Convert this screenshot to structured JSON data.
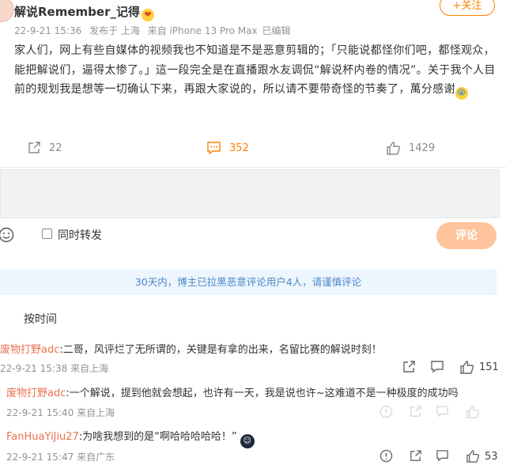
{
  "post": {
    "username": "解说Remember_记得",
    "username_emoji": "❤",
    "follow_label": "+关注",
    "time": "22-9-21 15:36",
    "location": "发布于 上海",
    "device": "来自 iPhone 13 Pro Max",
    "edited": "已编辑",
    "content_main": "家人们，网上有些自媒体的视频我也不知道是不是恶意剪辑的；「只能说都怪你们吧，都怪观众，能把解说们，逼得太惨了。」這一段完全是在直播跟水友调侃“解说杯内卷的情况”。关于我个人目前的规划我是想等一切确认下来，再跟大家说的，所以请不要带奇怪的节奏了，萬分感谢",
    "content_emoji": "😭",
    "reposts": "22",
    "comments": "352",
    "likes": "1429"
  },
  "composer": {
    "repost_label": "同时转发",
    "submit_label": "评论"
  },
  "notice": "30天内，博主已拉黑恶意评论用户4人，请谨慎评论",
  "sort_label": "按时间",
  "comments": [
    {
      "user": "废物打野adc",
      "text": ":二哥，风评烂了无所谓的，关键是有拿的出来，名留比赛的解说时刻！",
      "time": "22-9-21 15:38",
      "source": "来自上海",
      "likes": "151"
    },
    {
      "user": "废物打野adc",
      "text": ":一个解说，提到他就会想起，也许有一天，我是说也许~这难道不是一种极度的成功吗",
      "time": "22-9-21 15:40",
      "source": "来自上海",
      "likes": ""
    },
    {
      "user": "FanHuaYiJiu27",
      "text": ":为啥我想到的是“啊哈哈哈哈哈！”",
      "emoji": "☺",
      "time": "22-9-21 15:47",
      "source": "来自广东",
      "likes": "53"
    }
  ],
  "colors": {
    "accent": "#ff8200",
    "username_link": "#eb7350",
    "notice_bg": "#edf5fd",
    "notice_text": "#4a88c7",
    "submit_bg": "#ffc49b"
  }
}
